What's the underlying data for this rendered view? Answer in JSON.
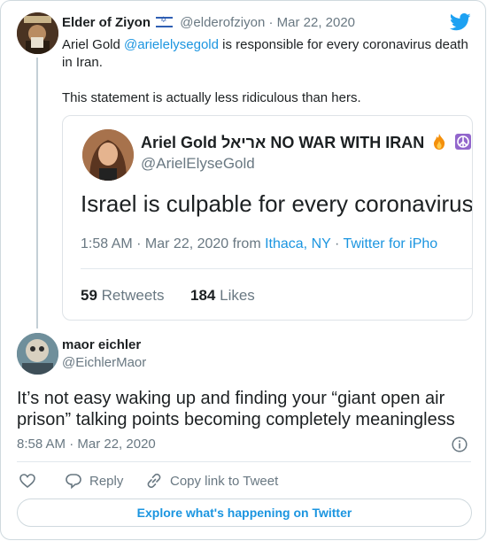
{
  "parent_tweet": {
    "author_name": "Elder of Ziyon",
    "author_handle": "@elderofziyon",
    "date": "Mar 22, 2020",
    "text_prefix": "Ariel Gold ",
    "mention": "@arielelysegold",
    "text_suffix": " is responsible for every coronavirus death in Iran.",
    "text_line2": "This statement is actually less ridiculous than hers.",
    "flag_icon": "israel-flag-icon"
  },
  "quoted_tweet": {
    "author_name": "Ariel Gold אריאל NO WAR WITH IRAN",
    "author_handle": "@ArielElyseGold",
    "text": "Israel is culpable for every coronavirus d",
    "time": "1:58 AM · Mar 22, 2020 from ",
    "location": "Ithaca, NY",
    "separator": " · ",
    "source": "Twitter for iPho",
    "retweets_count": "59",
    "retweets_label": "Retweets",
    "likes_count": "184",
    "likes_label": "Likes"
  },
  "main_tweet": {
    "author_name": "maor eichler",
    "author_handle": "@EichlerMaor",
    "text": "It’s not easy waking up and finding your “giant open air prison” talking points becoming completely meaningless",
    "timestamp": "8:58 AM · Mar 22, 2020"
  },
  "actions": {
    "reply_label": "Reply",
    "copy_link_label": "Copy link to Tweet"
  },
  "explore_label": "Explore what's happening on Twitter",
  "colors": {
    "link_blue": "#1b95e0",
    "text": "#1c2022",
    "muted": "#697882",
    "border": "#cfd9de"
  }
}
